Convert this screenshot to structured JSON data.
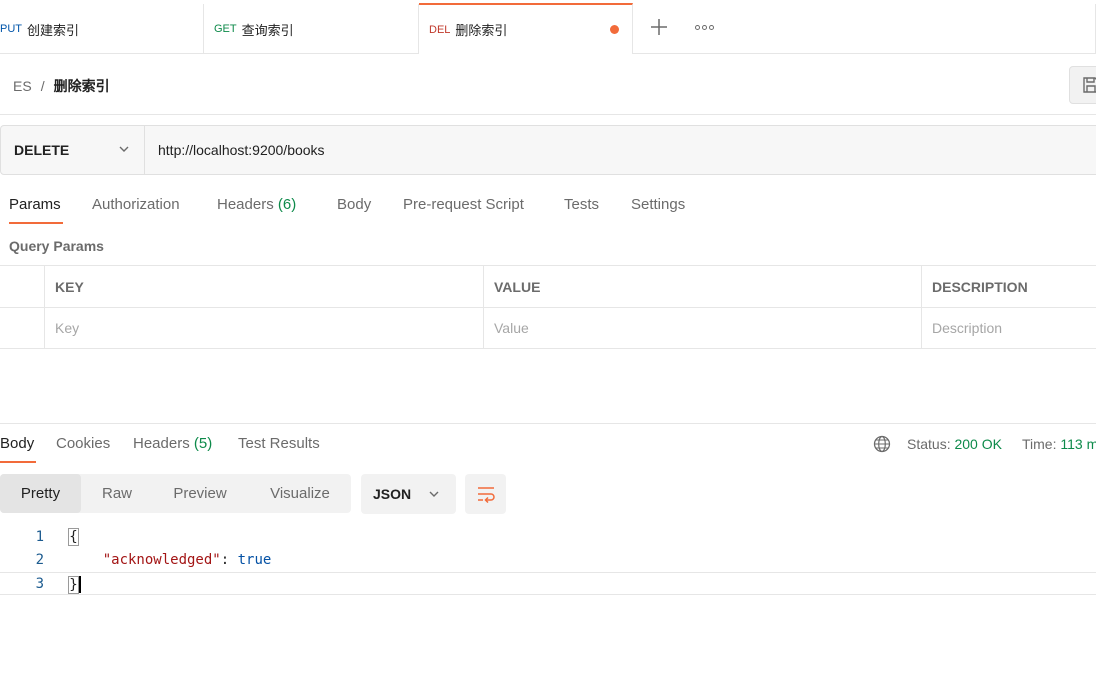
{
  "tabs": [
    {
      "method": "PUT",
      "label": "创建索引"
    },
    {
      "method": "GET",
      "label": "查询索引"
    },
    {
      "method": "DEL",
      "label": "删除索引"
    }
  ],
  "breadcrumb": {
    "root": "ES",
    "separator": "/",
    "current": "删除索引"
  },
  "request": {
    "method": "DELETE",
    "url": "http://localhost:9200/books"
  },
  "request_tabs": {
    "params": "Params",
    "authorization": "Authorization",
    "headers": "Headers",
    "headers_count": "(6)",
    "body": "Body",
    "pre_request": "Pre-request Script",
    "tests": "Tests",
    "settings": "Settings"
  },
  "query_params": {
    "title": "Query Params",
    "columns": [
      "KEY",
      "VALUE",
      "DESCRIPTION"
    ],
    "placeholders": [
      "Key",
      "Value",
      "Description"
    ]
  },
  "response_tabs": {
    "body": "Body",
    "cookies": "Cookies",
    "headers": "Headers",
    "headers_count": "(5)",
    "test_results": "Test Results"
  },
  "response_status": {
    "status_label": "Status:",
    "status_value": "200 OK",
    "time_label": "Time:",
    "time_value": "113 m"
  },
  "view_modes": [
    "Pretty",
    "Raw",
    "Preview",
    "Visualize"
  ],
  "format": "JSON",
  "code": {
    "line_numbers": [
      "1",
      "2",
      "3"
    ],
    "open_brace": "{",
    "key": "\"acknowledged\"",
    "colon": ": ",
    "value": "true",
    "close_brace": "}"
  },
  "colors": {
    "accent": "#f26b3a",
    "success": "#0d8a4a",
    "put_method": "#0055aa",
    "get_method": "#0d8a4a",
    "del_method": "#c0392b"
  },
  "icons": [
    "plus-icon",
    "more-dots-icon",
    "save-icon",
    "chevron-down-icon",
    "globe-icon",
    "wrap-lines-icon"
  ]
}
